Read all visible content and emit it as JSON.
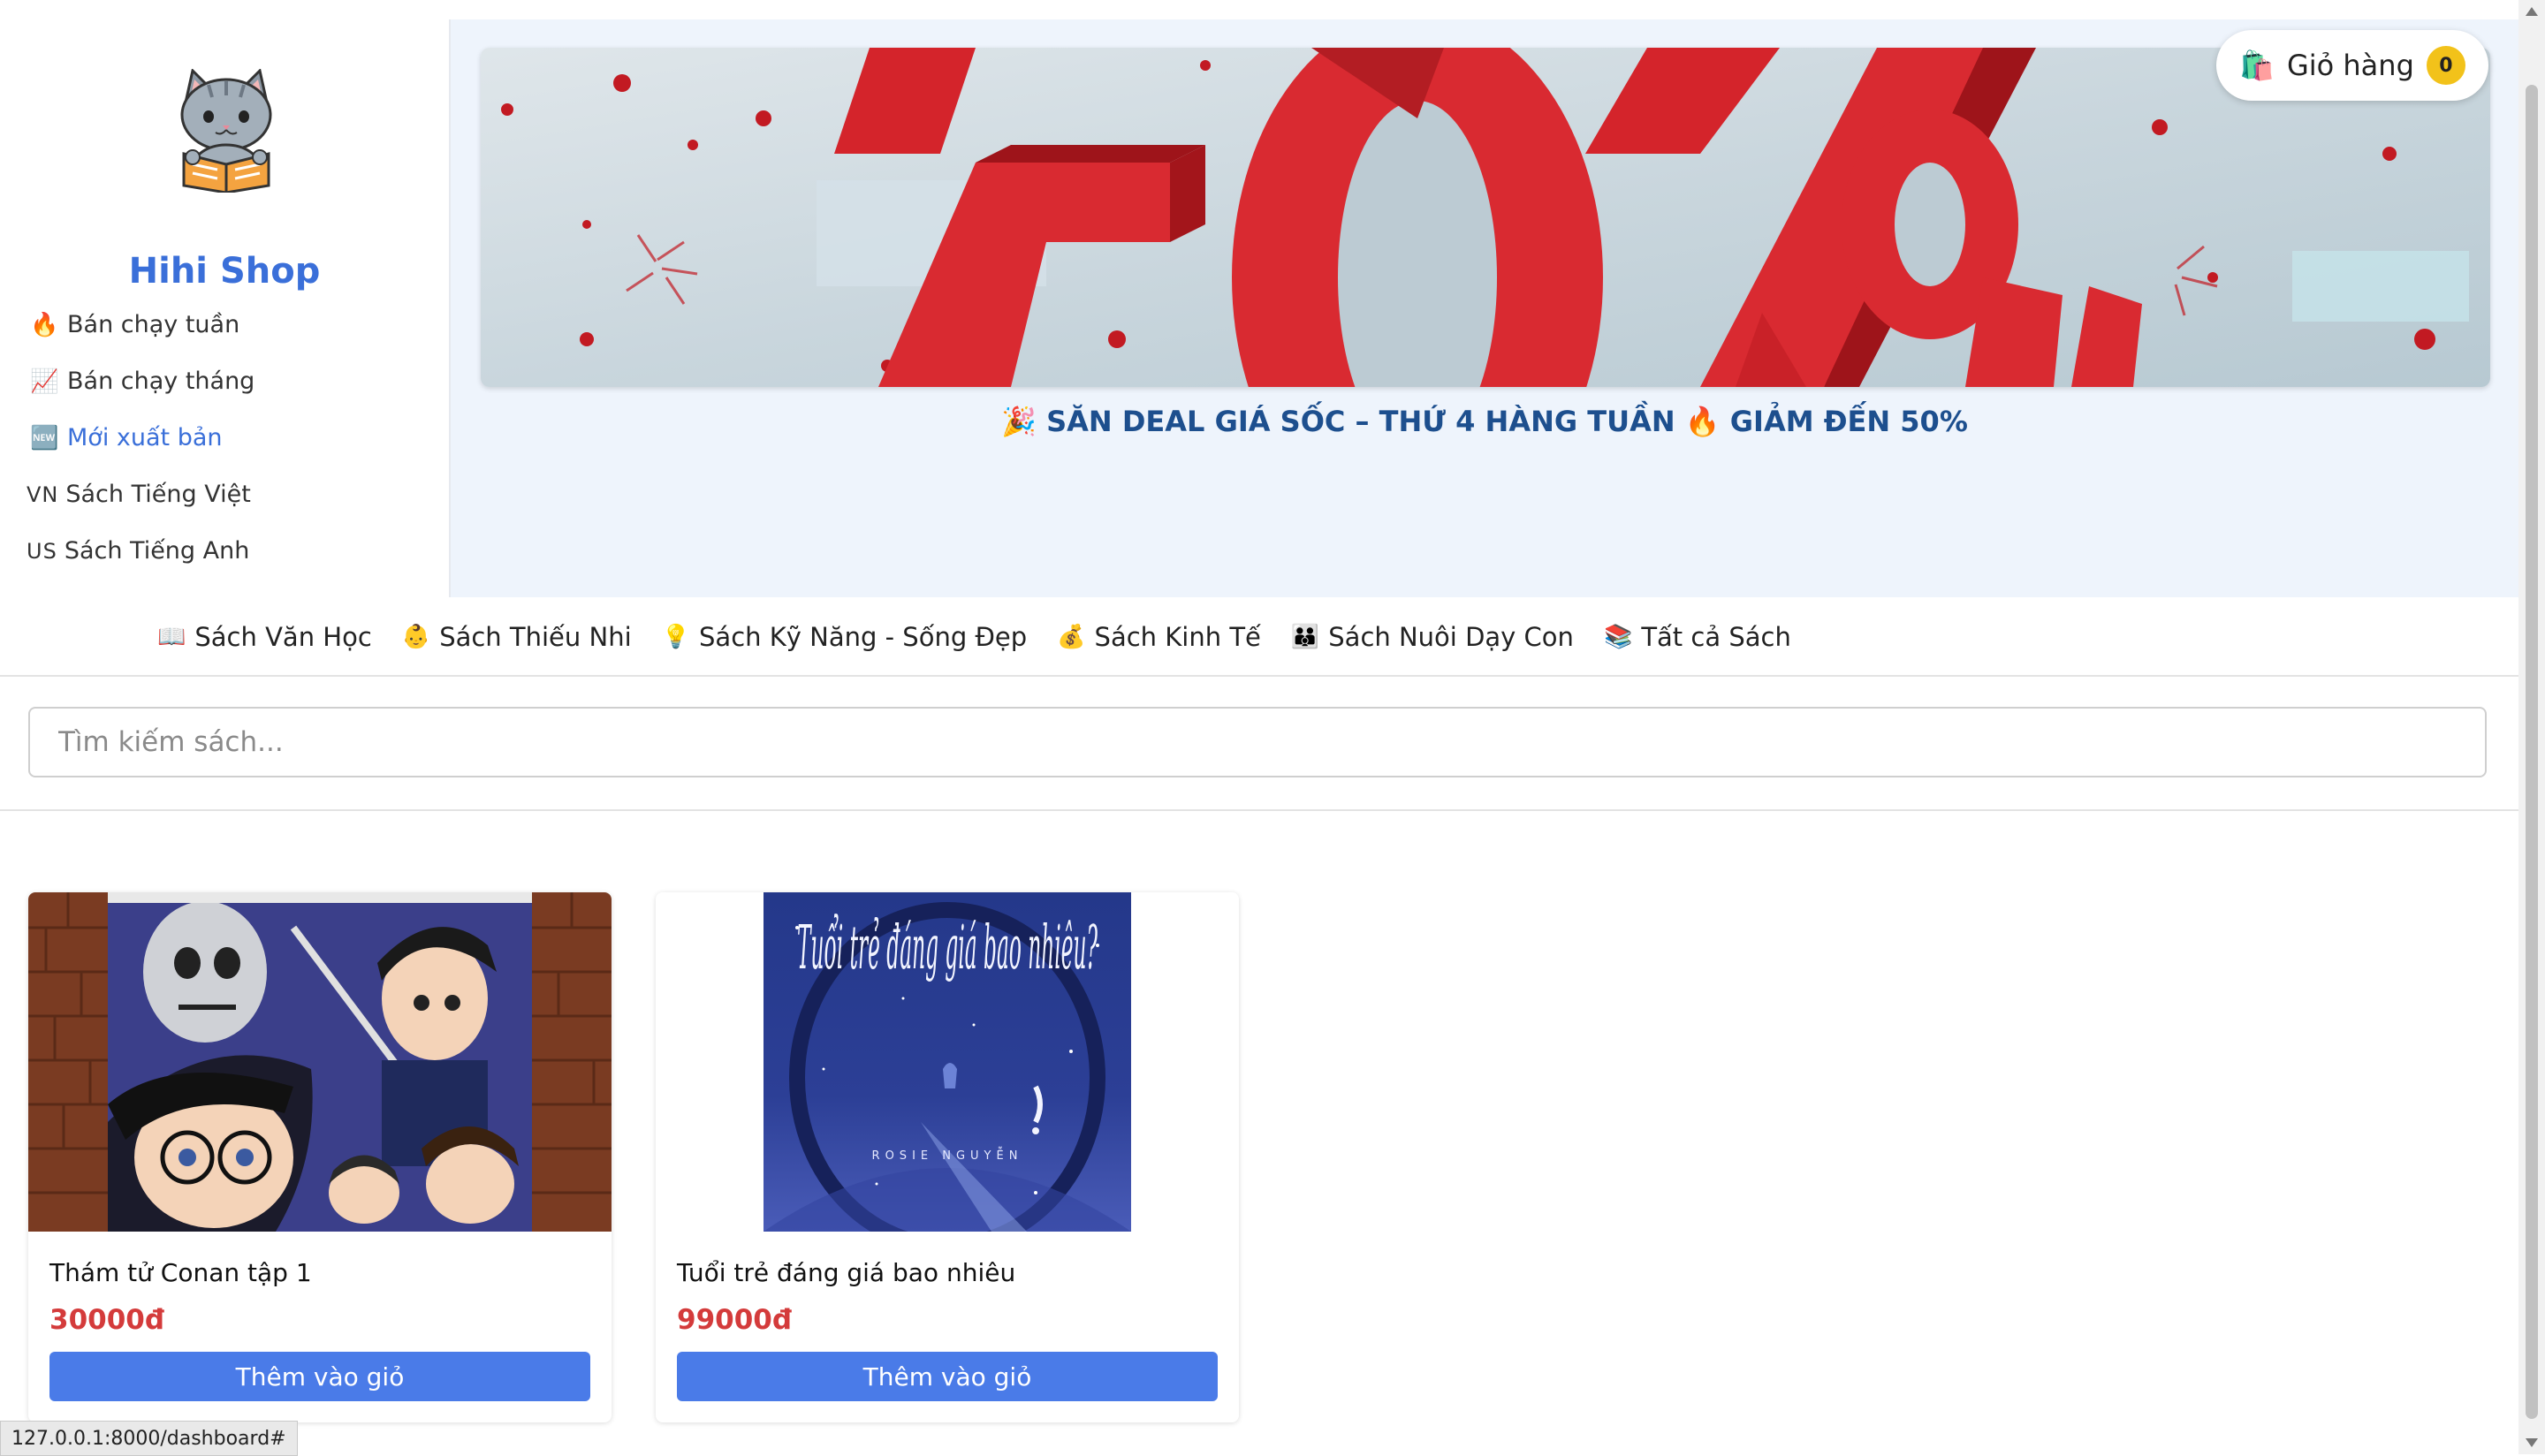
{
  "sidebar": {
    "shop_name": "Hihi Shop",
    "logo_icon": "cat-reading-book",
    "items": [
      {
        "icon": "🔥",
        "label": "Bán chạy tuần"
      },
      {
        "icon": "📈",
        "label": "Bán chạy tháng"
      },
      {
        "icon": "🆕",
        "label": "Mới xuất bản"
      },
      {
        "icon": "VN",
        "label": "Sách Tiếng Việt"
      },
      {
        "icon": "US",
        "label": "Sách Tiếng Anh"
      }
    ],
    "active_index": 2
  },
  "banner": {
    "deal_text": "🎉 SĂN DEAL GIÁ SỐC – THỨ 4 HÀNG TUẦN 🔥 GIẢM ĐẾN 50%"
  },
  "cart": {
    "icon": "🛍️",
    "label": "Giỏ hàng",
    "count": "0"
  },
  "categories": [
    {
      "icon": "📖",
      "label": "Sách Văn Học"
    },
    {
      "icon": "👶",
      "label": "Sách Thiếu Nhi"
    },
    {
      "icon": "💡",
      "label": "Sách Kỹ Năng - Sống Đẹp"
    },
    {
      "icon": "💰",
      "label": "Sách Kinh Tế"
    },
    {
      "icon": "👪",
      "label": "Sách Nuôi Dạy Con"
    },
    {
      "icon": "📚",
      "label": "Tất cả Sách"
    }
  ],
  "search": {
    "placeholder": "Tìm kiếm sách..."
  },
  "products": [
    {
      "title": "Thám tử Conan tập 1",
      "price": "30000đ",
      "button": "Thêm vào giỏ",
      "cover": "detective-conan-cover"
    },
    {
      "title": "Tuổi trẻ đáng giá bao nhiêu",
      "price": "99000đ",
      "button": "Thêm vào giỏ",
      "cover": "tuoi-tre-dang-gia-bao-nhieu-cover",
      "cover_text": "Tuổi trẻ đáng giá bao nhiêu?",
      "cover_author": "ROSIE NGUYỄN"
    }
  ],
  "status_url": "127.0.0.1:8000/dashboard#",
  "colors": {
    "accent": "#3a6fd9",
    "button": "#4a7be8",
    "price": "#d43b3b",
    "badge": "#f2c21a",
    "banner_bg": "#eef4fc"
  }
}
